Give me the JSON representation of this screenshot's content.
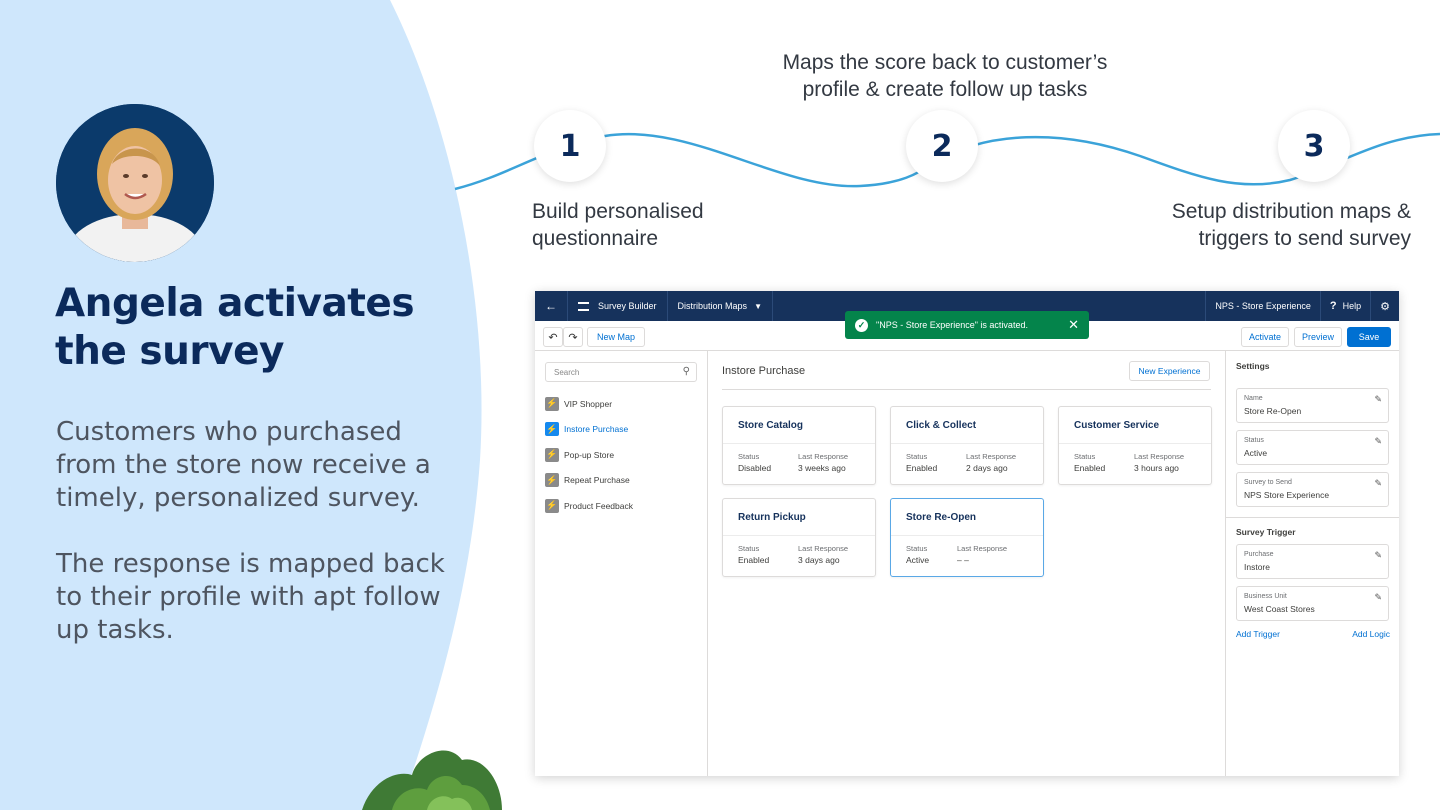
{
  "slide": {
    "headline": "Angela activates the survey",
    "para1": "Customers who purchased from the store now receive a timely, personalized survey.",
    "para2": "The response is mapped back to their profile with apt follow up tasks."
  },
  "steps": [
    {
      "number": "1",
      "caption": "Build personalised questionnaire"
    },
    {
      "number": "2",
      "caption": "Maps the score back to customer’s profile & create follow up tasks"
    },
    {
      "number": "3",
      "caption": "Setup distribution maps & triggers to send survey"
    }
  ],
  "app": {
    "topbar": {
      "back_icon": "←",
      "app_name": "Survey Builder",
      "tab": "Distribution Maps",
      "record": "NPS - Store Experience",
      "help_label": "Help"
    },
    "toolbar": {
      "undo_icon": "↶",
      "redo_icon": "↷",
      "new_map": "New Map",
      "activate": "Activate",
      "preview": "Preview",
      "save": "Save"
    },
    "toast": {
      "message": "\"NPS - Store Experience\" is activated.",
      "close_icon": "✕"
    },
    "sidebar": {
      "search_placeholder": "Search",
      "items": [
        {
          "label": "VIP Shopper"
        },
        {
          "label": "Instore Purchase"
        },
        {
          "label": "Pop-up Store"
        },
        {
          "label": "Repeat Purchase"
        },
        {
          "label": "Product Feedback"
        }
      ],
      "active_index": 1
    },
    "main": {
      "title": "Instore Purchase",
      "new_experience": "New Experience",
      "status_label": "Status",
      "last_response_label": "Last Response",
      "cards": [
        {
          "title": "Store Catalog",
          "status": "Disabled",
          "last_response": "3 weeks ago"
        },
        {
          "title": "Click & Collect",
          "status": "Enabled",
          "last_response": "2 days ago"
        },
        {
          "title": "Customer Service",
          "status": "Enabled",
          "last_response": "3 hours ago"
        },
        {
          "title": "Return Pickup",
          "status": "Enabled",
          "last_response": "3 days ago"
        },
        {
          "title": "Store Re-Open",
          "status": "Active",
          "last_response": "– –"
        }
      ]
    },
    "settings": {
      "heading": "Settings",
      "fields": [
        {
          "label": "Name",
          "value": "Store Re-Open"
        },
        {
          "label": "Status",
          "value": "Active"
        },
        {
          "label": "Survey to Send",
          "value": "NPS Store Experience"
        }
      ],
      "trigger_heading": "Survey Trigger",
      "trigger_fields": [
        {
          "label": "Purchase",
          "value": "Instore"
        },
        {
          "label": "Business Unit",
          "value": "West Coast Stores"
        }
      ],
      "add_trigger": "Add Trigger",
      "add_logic": "Add Logic"
    }
  },
  "colors": {
    "panel_bg": "#cfe7fc",
    "headline": "#0b2a5b",
    "wave": "#3ba3d9",
    "topbar": "#16325c",
    "brand_blue": "#0070d2",
    "toast_green": "#04844b"
  }
}
